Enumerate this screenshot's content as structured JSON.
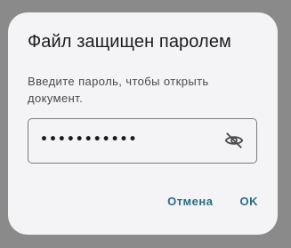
{
  "dialog": {
    "title": "Файл защищен паролем",
    "message": "Введите пароль, чтобы открыть документ.",
    "password": {
      "value": "•••••••••••",
      "visibility_icon": "eye-off-icon"
    },
    "buttons": {
      "cancel": "Отмена",
      "ok": "OK"
    }
  },
  "colors": {
    "accent": "#2a6b85",
    "dialog_background": "#f4f4f6",
    "scrim": "#8a8a8a"
  }
}
